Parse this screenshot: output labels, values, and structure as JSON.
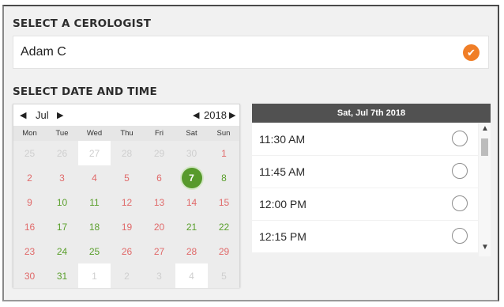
{
  "cerologist": {
    "title": "SELECT A CEROLOGIST",
    "selected_name": "Adam C",
    "check_icon": "✔"
  },
  "datetime": {
    "title": "SELECT DATE AND TIME"
  },
  "calendar": {
    "month": "Jul",
    "year": "2018",
    "prev_arrow": "◀",
    "next_arrow": "▶",
    "weekdays": [
      "Mon",
      "Tue",
      "Wed",
      "Thu",
      "Fri",
      "Sat",
      "Sun"
    ],
    "selected_day": "7",
    "days": [
      {
        "label": "25",
        "style": "faded",
        "bg": "grey"
      },
      {
        "label": "26",
        "style": "faded",
        "bg": "grey"
      },
      {
        "label": "27",
        "style": "faded",
        "bg": "white"
      },
      {
        "label": "28",
        "style": "faded",
        "bg": "grey"
      },
      {
        "label": "29",
        "style": "faded",
        "bg": "grey"
      },
      {
        "label": "30",
        "style": "faded",
        "bg": "grey"
      },
      {
        "label": "1",
        "style": "pink",
        "bg": "grey"
      },
      {
        "label": "2",
        "style": "pink",
        "bg": "grey"
      },
      {
        "label": "3",
        "style": "pink",
        "bg": "grey"
      },
      {
        "label": "4",
        "style": "pink",
        "bg": "grey"
      },
      {
        "label": "5",
        "style": "pink",
        "bg": "grey"
      },
      {
        "label": "6",
        "style": "pink",
        "bg": "grey"
      },
      {
        "label": "7",
        "style": "selected",
        "bg": "grey"
      },
      {
        "label": "8",
        "style": "green",
        "bg": "grey"
      },
      {
        "label": "9",
        "style": "pink",
        "bg": "grey"
      },
      {
        "label": "10",
        "style": "green",
        "bg": "grey"
      },
      {
        "label": "11",
        "style": "green",
        "bg": "grey"
      },
      {
        "label": "12",
        "style": "pink",
        "bg": "grey"
      },
      {
        "label": "13",
        "style": "pink",
        "bg": "grey"
      },
      {
        "label": "14",
        "style": "pink",
        "bg": "grey"
      },
      {
        "label": "15",
        "style": "pink",
        "bg": "grey"
      },
      {
        "label": "16",
        "style": "pink",
        "bg": "grey"
      },
      {
        "label": "17",
        "style": "green",
        "bg": "grey"
      },
      {
        "label": "18",
        "style": "green",
        "bg": "grey"
      },
      {
        "label": "19",
        "style": "pink",
        "bg": "grey"
      },
      {
        "label": "20",
        "style": "pink",
        "bg": "grey"
      },
      {
        "label": "21",
        "style": "green",
        "bg": "grey"
      },
      {
        "label": "22",
        "style": "green",
        "bg": "grey"
      },
      {
        "label": "23",
        "style": "pink",
        "bg": "grey"
      },
      {
        "label": "24",
        "style": "green",
        "bg": "grey"
      },
      {
        "label": "25",
        "style": "green",
        "bg": "grey"
      },
      {
        "label": "26",
        "style": "pink",
        "bg": "grey"
      },
      {
        "label": "27",
        "style": "pink",
        "bg": "grey"
      },
      {
        "label": "28",
        "style": "pink",
        "bg": "grey"
      },
      {
        "label": "29",
        "style": "pink",
        "bg": "grey"
      },
      {
        "label": "30",
        "style": "pink",
        "bg": "grey"
      },
      {
        "label": "31",
        "style": "green",
        "bg": "grey"
      },
      {
        "label": "1",
        "style": "faded",
        "bg": "white"
      },
      {
        "label": "2",
        "style": "faded",
        "bg": "grey"
      },
      {
        "label": "3",
        "style": "faded",
        "bg": "grey"
      },
      {
        "label": "4",
        "style": "faded",
        "bg": "white"
      },
      {
        "label": "5",
        "style": "faded",
        "bg": "grey"
      }
    ]
  },
  "times": {
    "header": "Sat, Jul 7th 2018",
    "slots": [
      "11:30 AM",
      "11:45 AM",
      "12:00 PM",
      "12:15 PM"
    ],
    "scroll_up": "▲",
    "scroll_down": "▼"
  },
  "colors": {
    "accent_orange": "#f07e27",
    "available_green": "#5a9f2c",
    "unavailable_pink": "#e06a6a",
    "header_dark": "#515151"
  }
}
